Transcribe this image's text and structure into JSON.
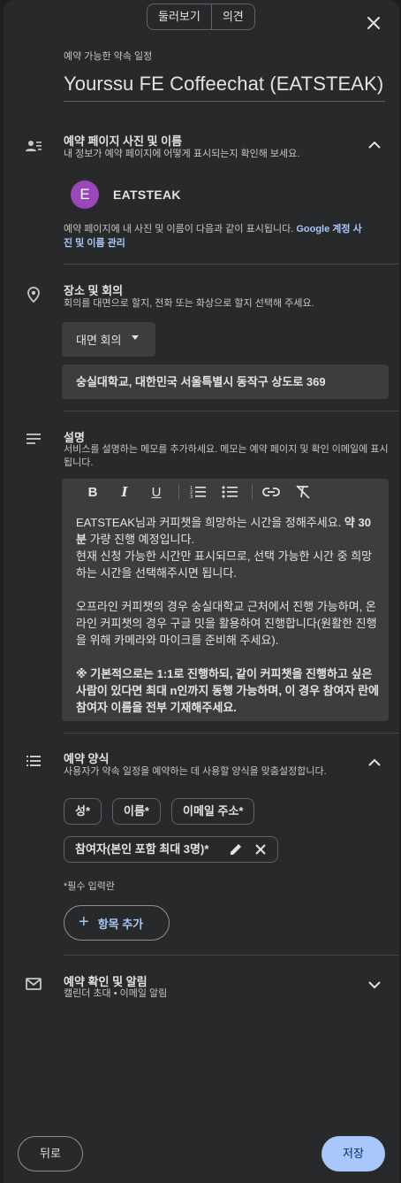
{
  "top_tabs": [
    "둘러보기",
    "의견"
  ],
  "header": {
    "small_label": "예약 가능한 약속 일정",
    "title": "Yourssu FE Coffeechat (EATSTEAK)"
  },
  "profile_section": {
    "icon": "person-list-icon",
    "title": "예약 페이지 사진 및 이름",
    "subtitle": "내 정보가 예약 페이지에 어떻게 표시되는지 확인해 보세요.",
    "avatar_letter": "E",
    "avatar_color": "#9c47b9",
    "name": "EATSTEAK",
    "note": "예약 페이지에 내 사진 및 이름이 다음과 같이 표시됩니다. ",
    "note_link": "Google 계정 사진 및 이름 관리"
  },
  "location_section": {
    "icon": "location-pin-icon",
    "title": "장소 및 회의",
    "subtitle": "회의를 대면으로 할지, 전화 또는 화상으로 할지 선택해 주세요.",
    "meeting_type": "대면 회의",
    "address": "숭실대학교, 대한민국 서울특별시 동작구 상도로 369"
  },
  "description_section": {
    "icon": "notes-icon",
    "title": "설명",
    "subtitle": "서비스를 설명하는 메모를 추가하세요. 메모는 예약 페이지 및 확인 이메일에 표시됩니다.",
    "toolbar": [
      "B",
      "I",
      "U"
    ],
    "para1_a": "EATSTEAK님과 커피챗을 희망하는 시간을 정해주세요. ",
    "para1_b": "약 30분",
    "para1_c": " 가량 진행 예정입니다.",
    "para1_d": "현재 신청 가능한 시간만 표시되므로, 선택 가능한 시간 중 희망하는 시간을 선택해주시면 됩니다.",
    "para2": "오프라인 커피챗의 경우 숭실대학교 근처에서 진행 가능하며, 온라인 커피챗의 경우 구글 밋을 활용하여 진행합니다(원활한 진행을 위해 카메라와 마이크를 준비해 주세요).",
    "para3": "※ 기본적으로는 1:1로 진행하되, 같이 커피챗을 진행하고 싶은 사람이 있다면 최대 n인까지 동행 가능하며, 이 경우 참여자 란에 참여자 이름을 전부 기재해주세요."
  },
  "form_section": {
    "icon": "list-icon",
    "title": "예약 양식",
    "subtitle": "사용자가 약속 일정을 예약하는 데 사용할 양식을 맞춤설정합니다.",
    "fields": [
      "성*",
      "이름*",
      "이메일 주소*"
    ],
    "custom_field": "참여자(본인 포함 최대 3명)*",
    "required_note": "*필수 입력란",
    "add_label": "항목 추가"
  },
  "notify_section": {
    "icon": "mail-icon",
    "title": "예약 확인 및 알림",
    "subtitle": "캘린더 초대 • 이메일 알림"
  },
  "footer": {
    "back_label": "뒤로",
    "save_label": "저장"
  },
  "colors": {
    "background": "#28292a",
    "accent": "#a8c7fa",
    "field_bg": "#3c3d3f"
  }
}
